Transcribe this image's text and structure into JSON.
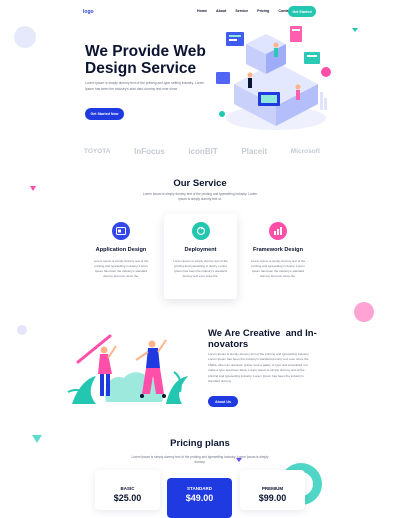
{
  "header": {
    "logo": "logo",
    "nav": [
      "Home",
      "About",
      "Service",
      "Pricing",
      "Contact"
    ],
    "cta": "Get Started"
  },
  "hero": {
    "title_line1": "We Provide Web",
    "title_line2": "Design Service",
    "text": "Lorem Ipsum is simply dummy text of the printing and type setting industry. Lorem Ipsum has been the industry's stan dard dummy text ever since.",
    "button": "Get Started Now"
  },
  "clients": [
    "TOYOTA",
    "InFocus",
    "iconBIT",
    "Placeit",
    "Microsoft"
  ],
  "service": {
    "title": "Our Service",
    "subtitle": "Lorem Ipsum is simply dummy text of the printing and typesetting industry. Lorem Ipsum is simply dummy text of.",
    "cards": [
      {
        "title": "Application Design",
        "text": "Lorem Ipsum is simply dummy text of the printing and typesetting in dustry. Lorem Ipsum has been the industry's standard dummy text ever since the."
      },
      {
        "title": "Deployment",
        "text": "Lorem Ipsum is simply dummy text of the printing and typesetting in dustry. Lorem Ipsum has been the industry's standard dummy text ever since the."
      },
      {
        "title": "Framework Design",
        "text": "Lorem Ipsum is simply dummy text of the printing and typesetting in dustry. Lorem Ipsum has been the industry's standard dummy text ever since the."
      }
    ]
  },
  "creative": {
    "title_line1": "We Are Creative  and In-",
    "title_line2": "novators",
    "text": "Lorem Ipsum is simply dummy text of the printing and typesetting industry. Lorem Ipsum has been the industry's standard dummy text ever since the 1500s, when an unknown printer took a galley of type and scrambled it to make a type specimen book. Lorem Ipsum is simply dummy text of the printing and typesetting industry. Lorem Ipsum has been the industry's standard dummy.",
    "button": "About Us"
  },
  "pricing": {
    "title": "Pricing plans",
    "subtitle": "Lorem Ipsum is simply dummy text of the printing and typesetting industry. Lorem Ipsum is simply dummy.",
    "plans": [
      {
        "name": "BASIC",
        "price": "$25.00"
      },
      {
        "name": "STANDARD",
        "price": "$49.00"
      },
      {
        "name": "PREMIUM",
        "price": "$99.00"
      }
    ]
  },
  "colors": {
    "primary": "#1e3ae0",
    "accent": "#22c6b1",
    "pink": "#ff72c4",
    "dark": "#0b1430"
  }
}
